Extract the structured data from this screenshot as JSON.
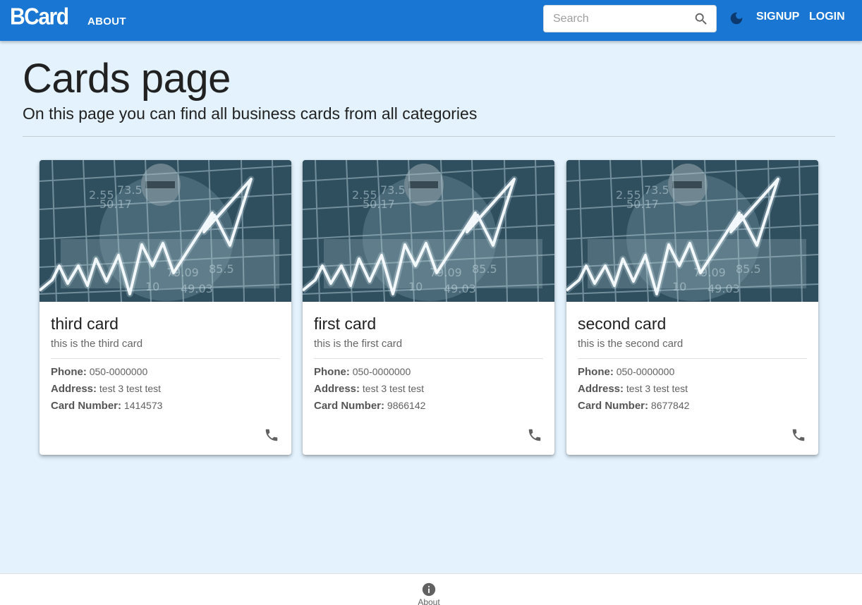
{
  "appbar": {
    "logo": "BCard",
    "about_label": "ABOUT",
    "search_placeholder": "Search",
    "signup_label": "SIGNUP",
    "login_label": "LOGIN",
    "color": "#1976d2"
  },
  "page": {
    "title": "Cards page",
    "subtitle": "On this page you can find all business cards from all categories",
    "background": "#e3f2fd"
  },
  "cards": [
    {
      "title": "third card",
      "subtitle": "this is the third card",
      "phone_label": "Phone:",
      "phone": "050-0000000",
      "address_label": "Address:",
      "address": "test 3 test test",
      "card_number_label": "Card Number:",
      "card_number": "1414573"
    },
    {
      "title": "first card",
      "subtitle": "this is the first card",
      "phone_label": "Phone:",
      "phone": "050-0000000",
      "address_label": "Address:",
      "address": "test 3 test test",
      "card_number_label": "Card Number:",
      "card_number": "9866142"
    },
    {
      "title": "second card",
      "subtitle": "this is the second card",
      "phone_label": "Phone:",
      "phone": "050-0000000",
      "address_label": "Address:",
      "address": "test 3 test test",
      "card_number_label": "Card Number:",
      "card_number": "8677842"
    }
  ],
  "icons": {
    "search": "search-icon",
    "theme": "moon-icon",
    "card_action": "phone-icon",
    "bottom": "info-icon"
  },
  "bottom_nav": {
    "about_label": "About"
  }
}
